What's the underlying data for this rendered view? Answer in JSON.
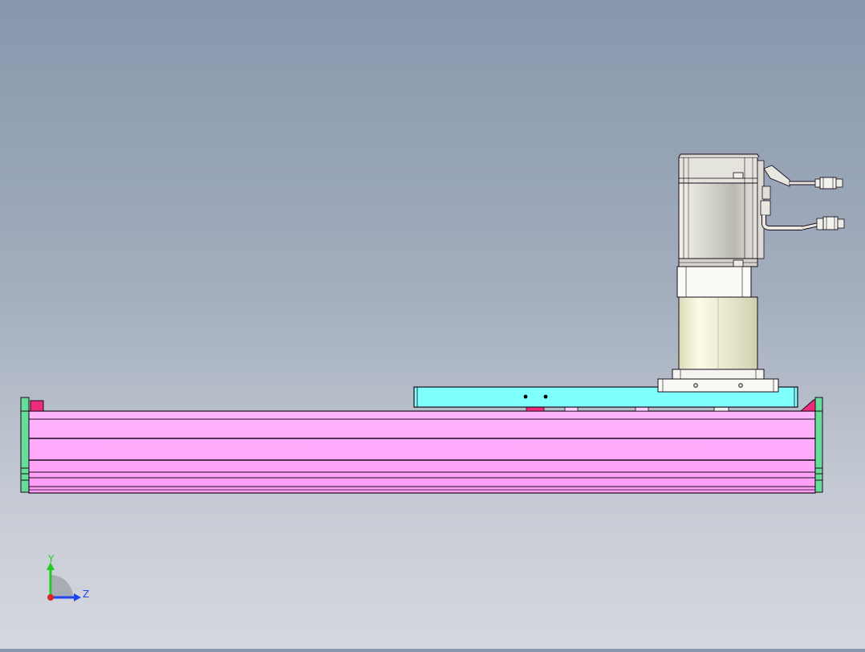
{
  "viewport": {
    "background_top": "#8797ac",
    "background_bottom": "#d6d8df"
  },
  "model": {
    "rail_color": "#ffa6ff",
    "rail_edge_color": "#1a0a1a",
    "end_cap_color": "#66dd99",
    "carriage_color": "#80ffff",
    "motor_color": "#d0d0c8",
    "bumper_color": "#ee2a7b",
    "cable_color": "#e8e8e0"
  },
  "triad": {
    "y_label": "Y",
    "z_label": "Z",
    "y_color": "#22cc22",
    "z_color": "#2244ee",
    "x_color": "#dd2222"
  }
}
